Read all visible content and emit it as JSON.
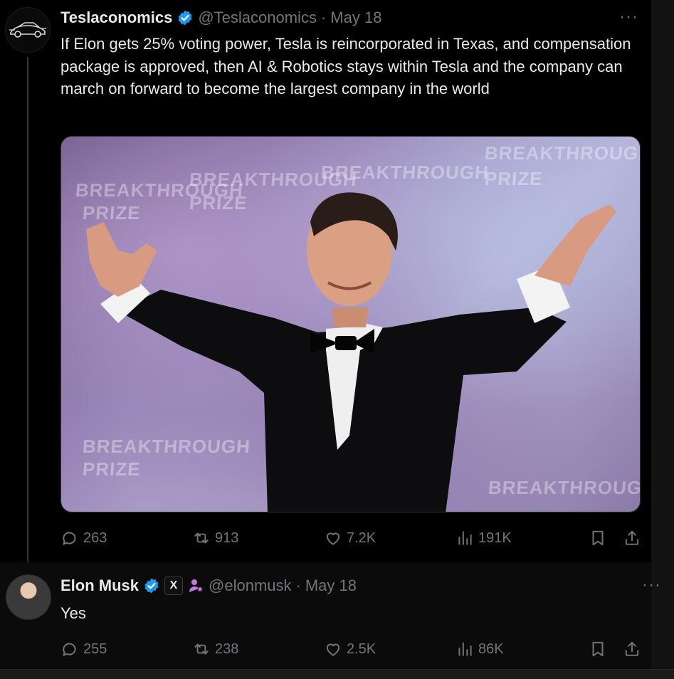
{
  "tweet1": {
    "display_name": "Teslaconomics",
    "handle": "@Teslaconomics",
    "dot": "·",
    "date": "May 18",
    "more": "···",
    "text": "If Elon gets 25% voting power, Tesla is reincorporated in Texas, and compensation package is approved, then AI & Robotics stays within Tesla and the company can march on forward to become the largest company in the world",
    "media_alt": "Photo",
    "backdrop_words": [
      "BREAKTHROUGH",
      "PRIZE",
      "BREAKTHROUGH",
      "PRIZE",
      "BREAKTHROUGH",
      "BREAKTHROUGH",
      "PRIZE",
      "BREAKTHROUGH",
      "PRIZE",
      "BREAKTHROUGH"
    ],
    "stats": {
      "replies": "263",
      "reposts": "913",
      "likes": "7.2K",
      "views": "191K"
    }
  },
  "tweet2": {
    "display_name": "Elon Musk",
    "affiliate_badge": "X",
    "handle": "@elonmusk",
    "dot": "·",
    "date": "May 18",
    "more": "···",
    "text": "Yes",
    "stats": {
      "replies": "255",
      "reposts": "238",
      "likes": "2.5K",
      "views": "86K"
    }
  },
  "icons": [
    "car-logo-icon",
    "verified-icon",
    "reply-icon",
    "repost-icon",
    "like-icon",
    "views-icon",
    "bookmark-icon",
    "share-icon",
    "x-affiliate-icon",
    "person-badge-icon"
  ],
  "colors": {
    "background": "#000000",
    "text": "#e7e9ea",
    "muted": "#71767b",
    "verified": "#1d9bf0",
    "badge_purple": "#c678dd"
  }
}
